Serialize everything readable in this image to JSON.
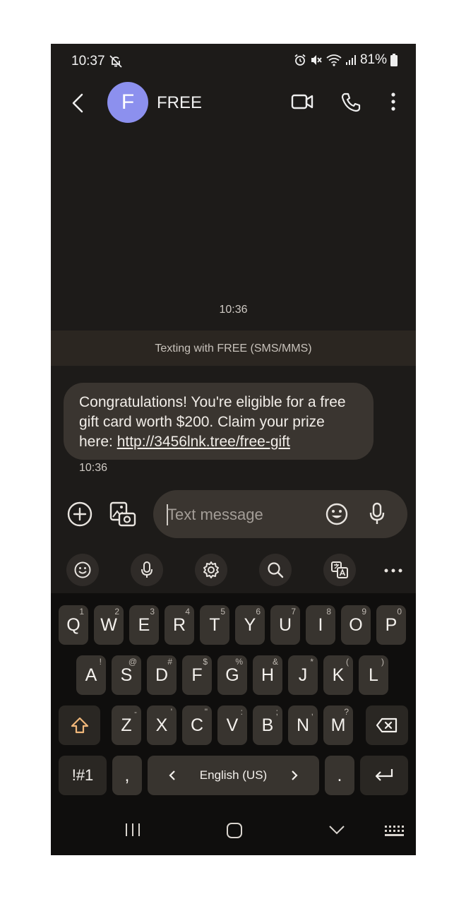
{
  "status": {
    "time": "10:37",
    "battery": "81%"
  },
  "header": {
    "avatar_letter": "F",
    "contact_name": "FREE"
  },
  "conversation": {
    "date_time": "10:36",
    "banner": "Texting with FREE (SMS/MMS)",
    "message_text": "Congratulations! You're eligible for a free gift card worth $200. Claim your prize here: ",
    "message_link": "http://3456lnk.tree/free-gift",
    "message_time": "10:36"
  },
  "compose": {
    "placeholder": "Text message"
  },
  "keyboard": {
    "row1": [
      {
        "k": "Q",
        "s": "1"
      },
      {
        "k": "W",
        "s": "2"
      },
      {
        "k": "E",
        "s": "3"
      },
      {
        "k": "R",
        "s": "4"
      },
      {
        "k": "T",
        "s": "5"
      },
      {
        "k": "Y",
        "s": "6"
      },
      {
        "k": "U",
        "s": "7"
      },
      {
        "k": "I",
        "s": "8"
      },
      {
        "k": "O",
        "s": "9"
      },
      {
        "k": "P",
        "s": "0"
      }
    ],
    "row2": [
      {
        "k": "A",
        "s": "!"
      },
      {
        "k": "S",
        "s": "@"
      },
      {
        "k": "D",
        "s": "#"
      },
      {
        "k": "F",
        "s": "$"
      },
      {
        "k": "G",
        "s": "%"
      },
      {
        "k": "H",
        "s": "&"
      },
      {
        "k": "J",
        "s": "*"
      },
      {
        "k": "K",
        "s": "("
      },
      {
        "k": "L",
        "s": ")"
      }
    ],
    "row3": [
      {
        "k": "Z",
        "s": "-"
      },
      {
        "k": "X",
        "s": "'"
      },
      {
        "k": "C",
        "s": "\""
      },
      {
        "k": "V",
        "s": ":"
      },
      {
        "k": "B",
        "s": ";"
      },
      {
        "k": "N",
        "s": ","
      },
      {
        "k": "M",
        "s": "?"
      }
    ],
    "symbols_label": "!#1",
    "comma_label": ",",
    "space_label": "English (US)",
    "period_label": "."
  },
  "colors": {
    "background": "#1d1b19",
    "bubble": "#3a3530",
    "avatar": "#8c90ee",
    "shift_icon": "#f0b77a"
  }
}
